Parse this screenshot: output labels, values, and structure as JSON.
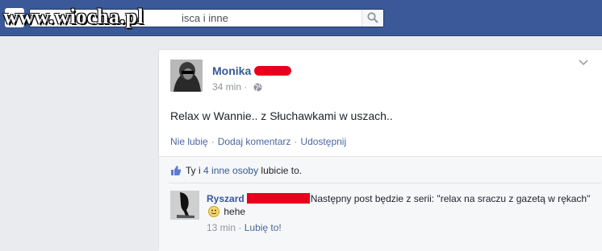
{
  "watermark": "www.wiocha.pl",
  "search": {
    "value": "isca i inne"
  },
  "post": {
    "author": "Monika",
    "time": "34 min",
    "meta_sep": "·",
    "text": "Relax w Wannie.. z Słuchawkami w uszach..",
    "actions": {
      "like": "Nie lubię",
      "comment": "Dodaj komentarz",
      "share": "Udostępnij"
    },
    "action_sep": "·"
  },
  "likes": {
    "prefix": "Ty i",
    "others": "4 inne osoby",
    "suffix": "lubicie to."
  },
  "comment": {
    "author": "Ryszard",
    "text_before_emoji": "Następny post będzie z serii: \"relax na sraczu z gazetą w rękach\"",
    "text_after_emoji": "hehe",
    "time": "13 min",
    "sep": "·",
    "like": "Lubię to!"
  },
  "colors": {
    "topbar": "#3b5998",
    "link": "#365899",
    "redaction": "#e8001d"
  },
  "icons": {
    "search": "search-icon",
    "globe": "globe-icon",
    "like": "thumbs-up-icon",
    "menu": "chevron-down-icon"
  }
}
